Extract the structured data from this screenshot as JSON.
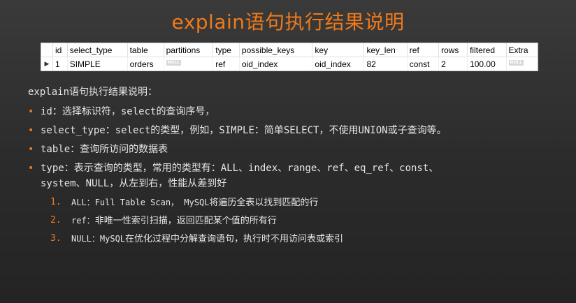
{
  "title": "explain语句执行结果说明",
  "table": {
    "columns": [
      "id",
      "select_type",
      "table",
      "partitions",
      "type",
      "possible_keys",
      "key",
      "key_len",
      "ref",
      "rows",
      "filtered",
      "Extra"
    ],
    "row": {
      "id": "1",
      "select_type": "SIMPLE",
      "table": "orders",
      "partitions": "NULL",
      "type": "ref",
      "possible_keys": "oid_index",
      "key": "oid_index",
      "key_len": "82",
      "ref": "const",
      "rows": "2",
      "filtered": "100.00",
      "Extra": "NULL"
    }
  },
  "intro": "explain语句执行结果说明：",
  "bullets": [
    {
      "code": "id：",
      "text": "选择标识符，",
      "code2": "select",
      "text2": "的查询序号，"
    },
    {
      "code": "select_type：select",
      "text": "的类型，例如，",
      "code2": "SIMPLE：",
      "text2": "简单",
      "code3": "SELECT",
      "text3": "，不使用",
      "code4": "UNION",
      "text4": "或子查询等。"
    },
    {
      "code": "table：",
      "text": "查询所访问的数据表"
    },
    {
      "code": "type：",
      "text": "表示查询的类型，常用的类型有：",
      "code2": "ALL、index、range、ref、eq_ref、const、",
      "code3": "system、NULL，",
      "text3": "从左到右，性能从差到好"
    }
  ],
  "subitems": [
    {
      "num": "1.",
      "code": "ALL：Full Table Scan， MySQL",
      "text": "将遍历全表以找到匹配的行"
    },
    {
      "num": "2.",
      "code": "ref：",
      "text": "非唯一性索引扫描，返回匹配某个值的所有行"
    },
    {
      "num": "3.",
      "code": "NULL：MySQL",
      "text": "在优化过程中分解查询语句，执行时不用访问表或索引"
    }
  ]
}
